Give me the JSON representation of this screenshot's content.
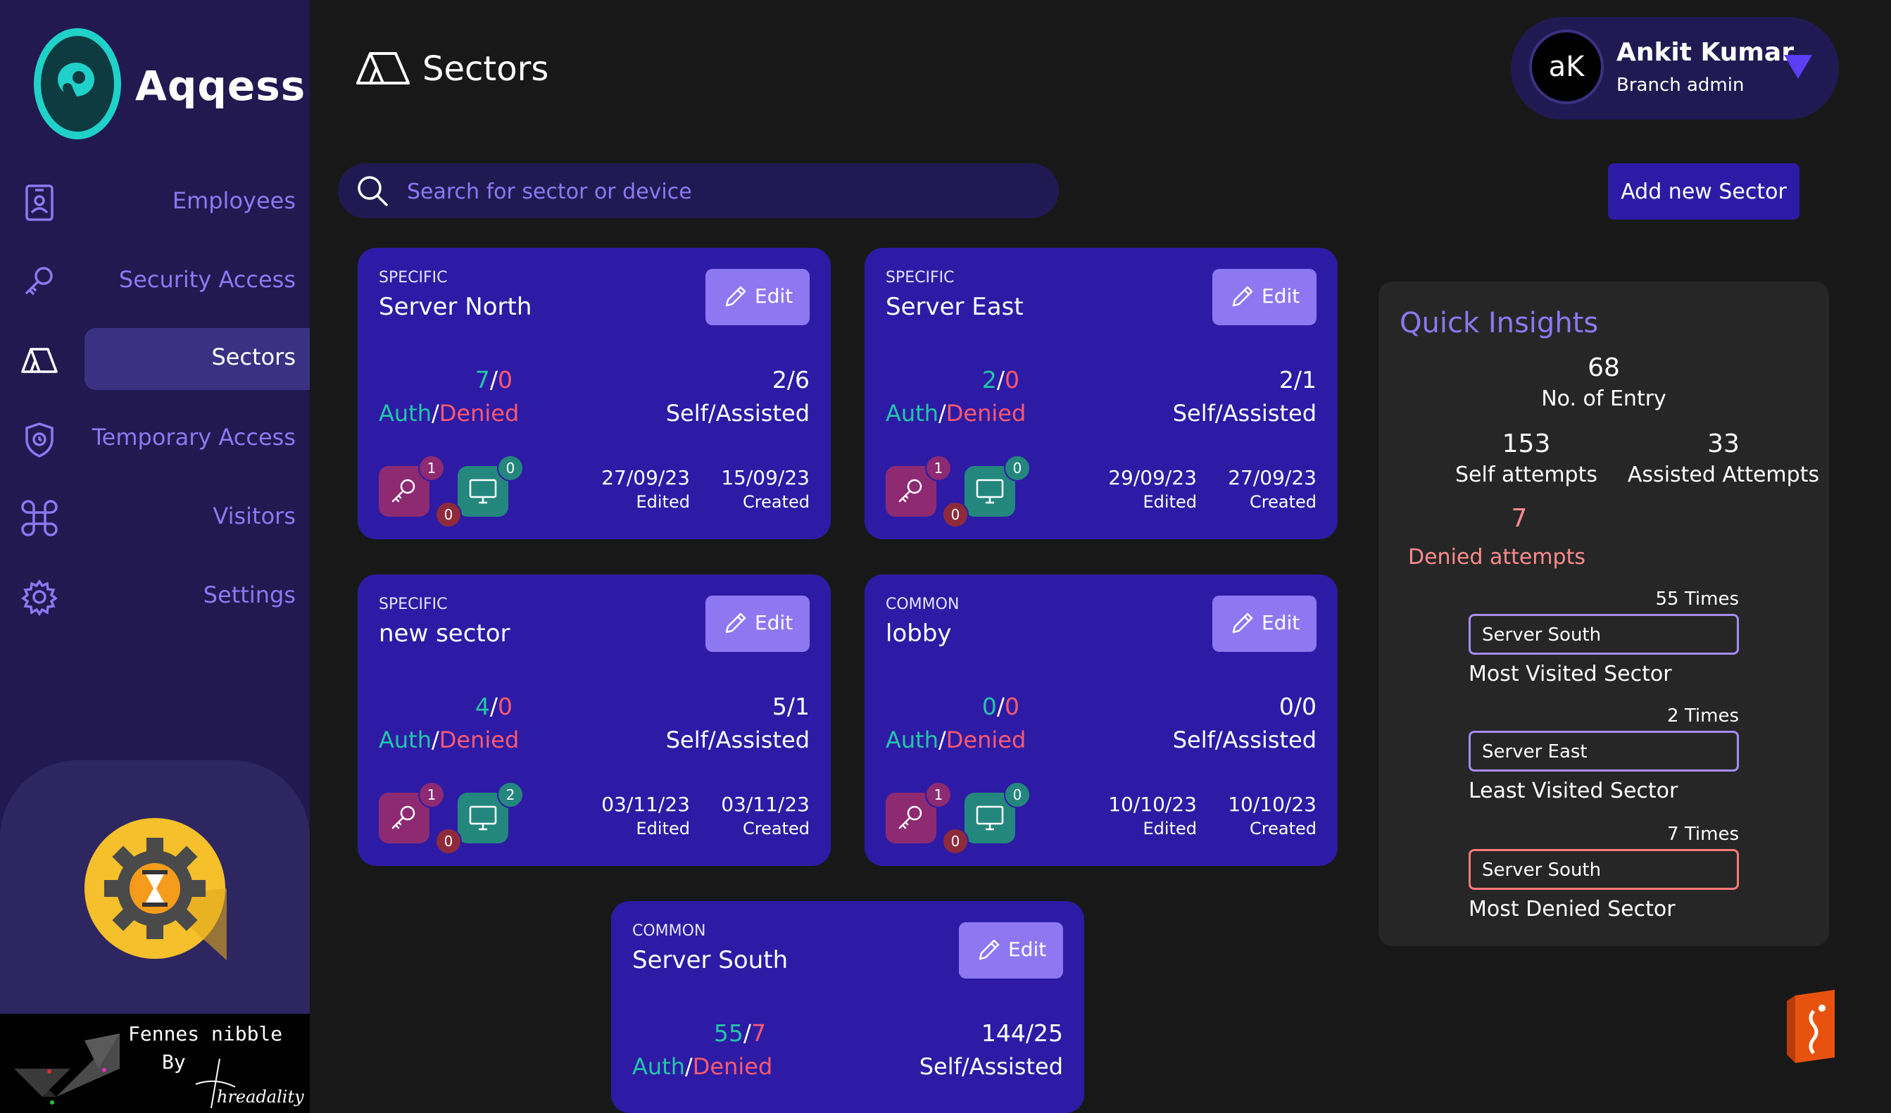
{
  "app": {
    "name": "Aqqess"
  },
  "sidebar": {
    "items": [
      {
        "label": "Employees",
        "icon": "id-badge-icon"
      },
      {
        "label": "Security Access",
        "icon": "key-icon"
      },
      {
        "label": "Sectors",
        "icon": "tent-icon",
        "active": true
      },
      {
        "label": "Temporary Access",
        "icon": "shield-clock-icon"
      },
      {
        "label": "Visitors",
        "icon": "command-icon"
      },
      {
        "label": "Settings",
        "icon": "gear-icon"
      }
    ]
  },
  "credit": {
    "line1": "Fennes nibble",
    "line2": "By",
    "brand": "hreadality"
  },
  "header": {
    "title": "Sectors"
  },
  "user": {
    "initials": "aK",
    "name": "Ankit Kumar",
    "role": "Branch admin"
  },
  "search": {
    "placeholder": "Search for sector or device",
    "value": ""
  },
  "actions": {
    "add_label": "Add new Sector"
  },
  "labels": {
    "edit": "Edit",
    "auth": "Auth",
    "slash": "/",
    "denied": "Denied",
    "self_assisted": "Self/Assisted",
    "edited": "Edited",
    "created": "Created"
  },
  "sectors": [
    {
      "type": "SPECIFIC",
      "name": "Server North",
      "auth": "7",
      "denied": "0",
      "ratio": "2/6",
      "keys": "1",
      "devices": "0",
      "denied_badge": "0",
      "edited": "27/09/23",
      "created": "15/09/23"
    },
    {
      "type": "SPECIFIC",
      "name": "Server East",
      "auth": "2",
      "denied": "0",
      "ratio": "2/1",
      "keys": "1",
      "devices": "0",
      "denied_badge": "0",
      "edited": "29/09/23",
      "created": "27/09/23"
    },
    {
      "type": "SPECIFIC",
      "name": "new sector",
      "auth": "4",
      "denied": "0",
      "ratio": "5/1",
      "keys": "1",
      "devices": "2",
      "denied_badge": "0",
      "edited": "03/11/23",
      "created": "03/11/23"
    },
    {
      "type": "COMMON",
      "name": "lobby",
      "auth": "0",
      "denied": "0",
      "ratio": "0/0",
      "keys": "1",
      "devices": "0",
      "denied_badge": "0",
      "edited": "10/10/23",
      "created": "10/10/23"
    },
    {
      "type": "COMMON",
      "name": "Server South",
      "auth": "55",
      "denied": "7",
      "ratio": "144/25"
    }
  ],
  "insights": {
    "title": "Quick Insights",
    "entries": {
      "value": "68",
      "label": "No. of Entry"
    },
    "self": {
      "value": "153",
      "label": "Self attempts"
    },
    "assisted": {
      "value": "33",
      "label": "Assisted Attempts"
    },
    "denied": {
      "value": "7",
      "label": "Denied attempts"
    },
    "most_visited": {
      "times": "55 Times",
      "sector": "Server South",
      "label": "Most Visited Sector"
    },
    "least_visited": {
      "times": "2 Times",
      "sector": "Server East",
      "label": "Least Visited Sector"
    },
    "most_denied": {
      "times": "7 Times",
      "sector": "Server South",
      "label": "Most Denied Sector"
    }
  },
  "colors": {
    "sidebar": "#21194f",
    "card": "#2d1ba5",
    "accent": "#8d78f2",
    "auth": "#22c7a8",
    "denied": "#ff5a6e",
    "background": "#181818"
  }
}
